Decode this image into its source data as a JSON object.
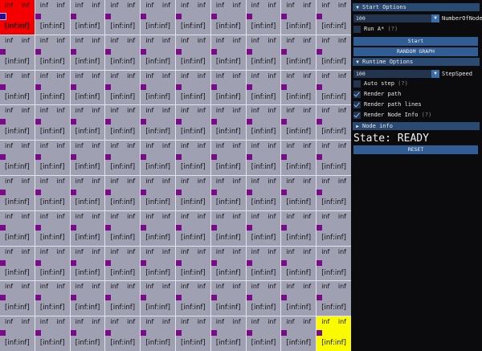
{
  "grid": {
    "rows": 10,
    "cols": 10,
    "cell_top_left": "inf",
    "cell_top_right": "inf",
    "cell_range": "[inf:inf]",
    "start_cell": [
      0,
      0
    ],
    "end_cell": [
      9,
      9
    ],
    "colors": {
      "cell": "#9fa1b3",
      "start": "#f50000",
      "end": "#fbfb00",
      "node": "#7a0a8a",
      "grid_line": "#e4e4ea"
    }
  },
  "panel": {
    "start_options": {
      "header": "Start Options",
      "number_of_nodes_value": "100",
      "number_of_nodes_label": "NumberOfNodes",
      "run_astar_label": "Run A*",
      "run_astar_help": "(?)",
      "run_astar_checked": false,
      "start_button": "Start",
      "random_graph_button": "RANDOM GRAPH"
    },
    "runtime_options": {
      "header": "Runtime Options",
      "step_speed_value": "100",
      "step_speed_label": "StepSpeed",
      "auto_step_label": "Auto step",
      "auto_step_help": "(?)",
      "auto_step_checked": false,
      "render_path_label": "Render path",
      "render_path_checked": true,
      "render_path_lines_label": "Render path lines",
      "render_path_lines_checked": true,
      "render_node_info_label": "Render Node Info",
      "render_node_info_help": "(?)",
      "render_node_info_checked": true
    },
    "node_info": {
      "header": "Node info"
    },
    "state_text": "State: READY",
    "reset_button": "RESET",
    "accent_color": "#2f5d94"
  }
}
